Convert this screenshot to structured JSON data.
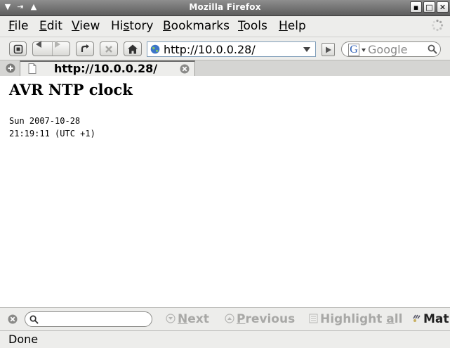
{
  "window": {
    "title": "Mozilla Firefox"
  },
  "menu": {
    "file": {
      "key": "F",
      "rest": "ile"
    },
    "edit": {
      "key": "E",
      "rest": "dit"
    },
    "view": {
      "key": "V",
      "rest": "iew"
    },
    "history": {
      "pre": "Hi",
      "key": "s",
      "rest": "tory"
    },
    "bookmarks": {
      "key": "B",
      "rest": "ookmarks"
    },
    "tools": {
      "key": "T",
      "rest": "ools"
    },
    "help": {
      "key": "H",
      "rest": "elp"
    }
  },
  "navigation": {
    "url": "http://10.0.0.28/",
    "search_placeholder": "Google"
  },
  "tab": {
    "label": "http://10.0.0.28/"
  },
  "page": {
    "heading": "AVR NTP clock",
    "date_line": "Sun 2007-10-28",
    "time_line": "21:19:11 (UTC +1)"
  },
  "findbar": {
    "next": {
      "key": "N",
      "rest": "ext"
    },
    "previous": {
      "key": "P",
      "rest": "revious"
    },
    "highlight": {
      "pre": "Highlight ",
      "key": "a",
      "rest": "ll"
    },
    "match_case": "Mat"
  },
  "status": {
    "text": "Done"
  }
}
